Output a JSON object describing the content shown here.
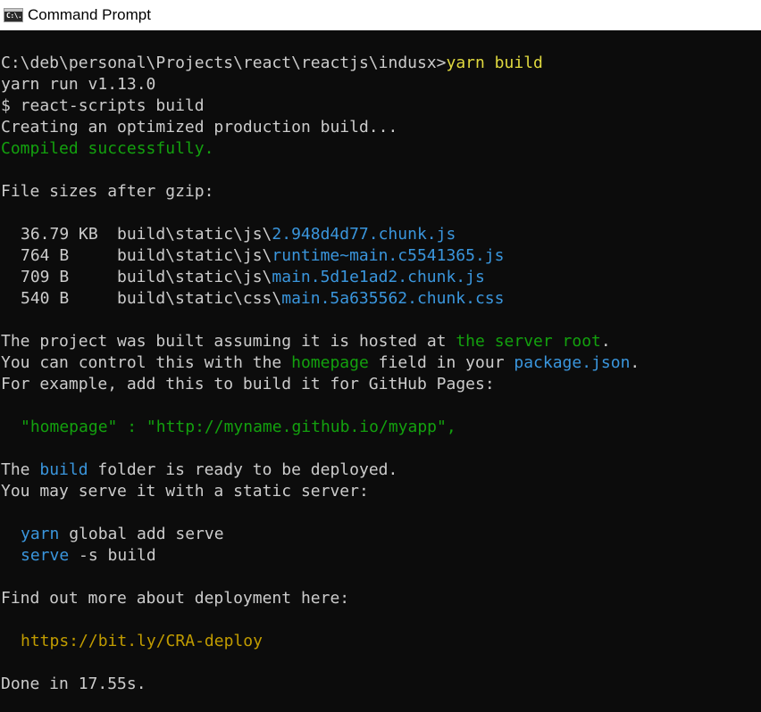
{
  "window": {
    "title": "Command Prompt",
    "icon": "cmd-icon",
    "icon_text": "C:\\."
  },
  "console": {
    "prompt": "C:\\deb\\personal\\Projects\\react\\reactjs\\indusx>",
    "command": "yarn build",
    "yarn_version": "yarn run v1.13.0",
    "script_line": "$ react-scripts build",
    "creating": "Creating an optimized production build...",
    "compiled": "Compiled successfully.",
    "file_sizes_heading": "File sizes after gzip:",
    "files": [
      {
        "size": "36.79 KB",
        "dir": "build\\static\\js\\",
        "name": "2.948d4d77.chunk.js"
      },
      {
        "size": "764 B",
        "dir": "build\\static\\js\\",
        "name": "runtime~main.c5541365.js"
      },
      {
        "size": "709 B",
        "dir": "build\\static\\js\\",
        "name": "main.5d1e1ad2.chunk.js"
      },
      {
        "size": "540 B",
        "dir": "build\\static\\css\\",
        "name": "main.5a635562.chunk.css"
      }
    ],
    "hosted_pre": "The project was built assuming it is hosted at ",
    "hosted_link": "the server root",
    "hosted_post": ".",
    "control_pre": "You can control this with the ",
    "control_homepage": "homepage",
    "control_mid": " field in your ",
    "control_pkg": "package.json",
    "control_post": ".",
    "example_line": "For example, add this to build it for GitHub Pages:",
    "homepage_json_key": "\"homepage\" : ",
    "homepage_json_value": "\"http://myname.github.io/myapp\",",
    "build_pre": "The ",
    "build_word": "build",
    "build_post": " folder is ready to be deployed.",
    "serve_line": "You may serve it with a static server:",
    "yarn_word": "yarn",
    "yarn_rest": " global add serve",
    "serve_word": "serve",
    "serve_rest": " -s build",
    "findout": "Find out more about deployment here:",
    "deploy_url": "https://bit.ly/CRA-deploy",
    "done": "Done in 17.55s."
  },
  "colors": {
    "background": "#0c0c0c",
    "text": "#cccccc",
    "yellow": "#e0d93f",
    "green": "#13a10e",
    "cyan": "#3a96dd",
    "gold": "#c19c00"
  }
}
